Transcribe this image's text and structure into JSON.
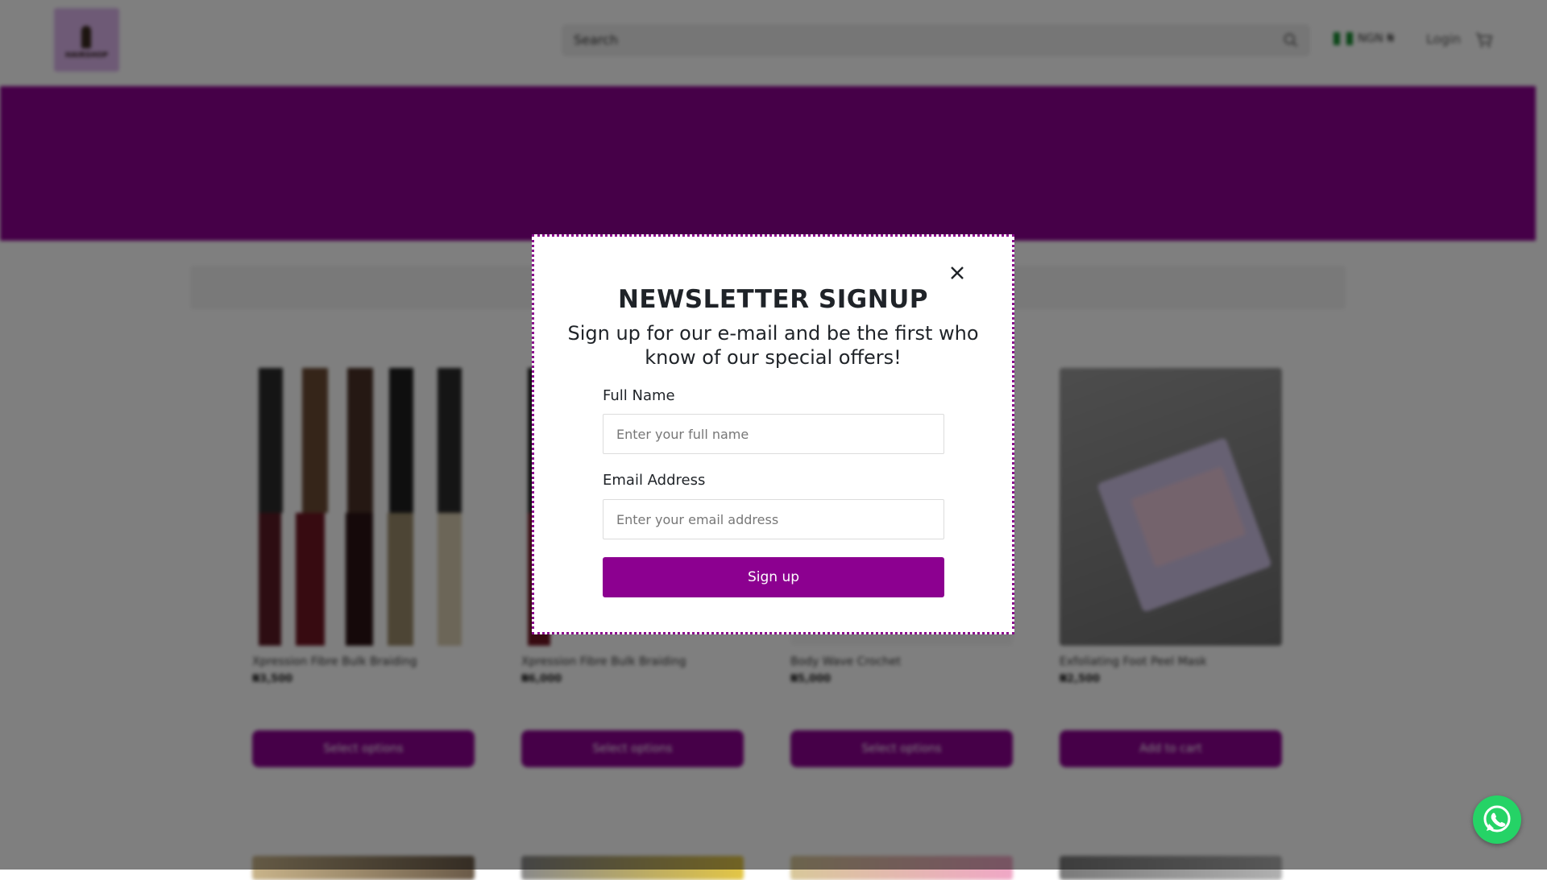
{
  "header": {
    "logo_text": "HAIRSHOP",
    "search_placeholder": "Search",
    "region_label": "NGN ₦",
    "login_label": "Login"
  },
  "products": [
    {
      "name": "Xpression Fibre Bulk Braiding",
      "price": "₦3,500",
      "button": "Select options"
    },
    {
      "name": "Xpression Fibre Bulk Braiding",
      "price": "₦6,000",
      "button": "Select options"
    },
    {
      "name": "Body Wave Crochet",
      "price": "₦5,000",
      "button": "Select options"
    },
    {
      "name": "Exfoliating Foot Peel Mask",
      "price": "₦2,500",
      "button": "Add to cart"
    }
  ],
  "modal": {
    "title": "NEWSLETTER SIGNUP",
    "subtitle": "Sign up for our e-mail and be the first who know of our special offers!",
    "name_label": "Full Name",
    "name_placeholder": "Enter your full name",
    "email_label": "Email Address",
    "email_placeholder": "Enter your email address",
    "submit_label": "Sign up"
  },
  "colors": {
    "brand_purple": "#8c0090",
    "modal_border": "#8a0d8c",
    "whatsapp_green": "#25d366"
  },
  "icons": [
    "search-icon",
    "cart-icon",
    "close-icon",
    "whatsapp-icon",
    "nigeria-flag-icon"
  ]
}
